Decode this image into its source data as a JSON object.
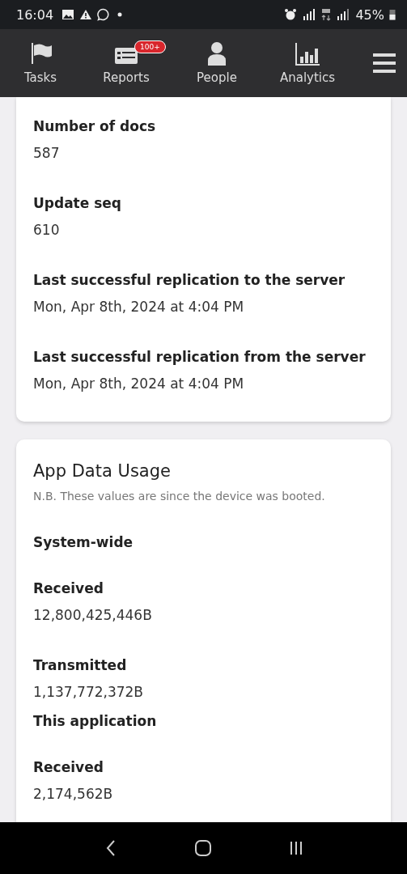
{
  "status_bar": {
    "time": "16:04",
    "battery": "45%"
  },
  "nav": {
    "tabs": [
      {
        "label": "Tasks",
        "kind": "flag"
      },
      {
        "label": "Reports",
        "kind": "report",
        "badge": "100+"
      },
      {
        "label": "People",
        "kind": "person"
      },
      {
        "label": "Analytics",
        "kind": "chart"
      }
    ]
  },
  "database_card": {
    "fields": [
      {
        "label": "Number of docs",
        "value": "587"
      },
      {
        "label": "Update seq",
        "value": "610"
      },
      {
        "label": "Last successful replication to the server",
        "value": "Mon, Apr 8th, 2024 at 4:04 PM"
      },
      {
        "label": "Last successful replication from the server",
        "value": "Mon, Apr 8th, 2024 at 4:04 PM"
      }
    ]
  },
  "data_usage_card": {
    "title": "App Data Usage",
    "note": "N.B. These values are since the device was booted.",
    "sections": [
      {
        "heading": "System-wide",
        "fields": [
          {
            "label": "Received",
            "value": "12,800,425,446B"
          },
          {
            "label": "Transmitted",
            "value": "1,137,772,372B"
          }
        ]
      },
      {
        "heading": "This application",
        "fields": [
          {
            "label": "Received",
            "value": "2,174,562B"
          }
        ]
      }
    ]
  }
}
